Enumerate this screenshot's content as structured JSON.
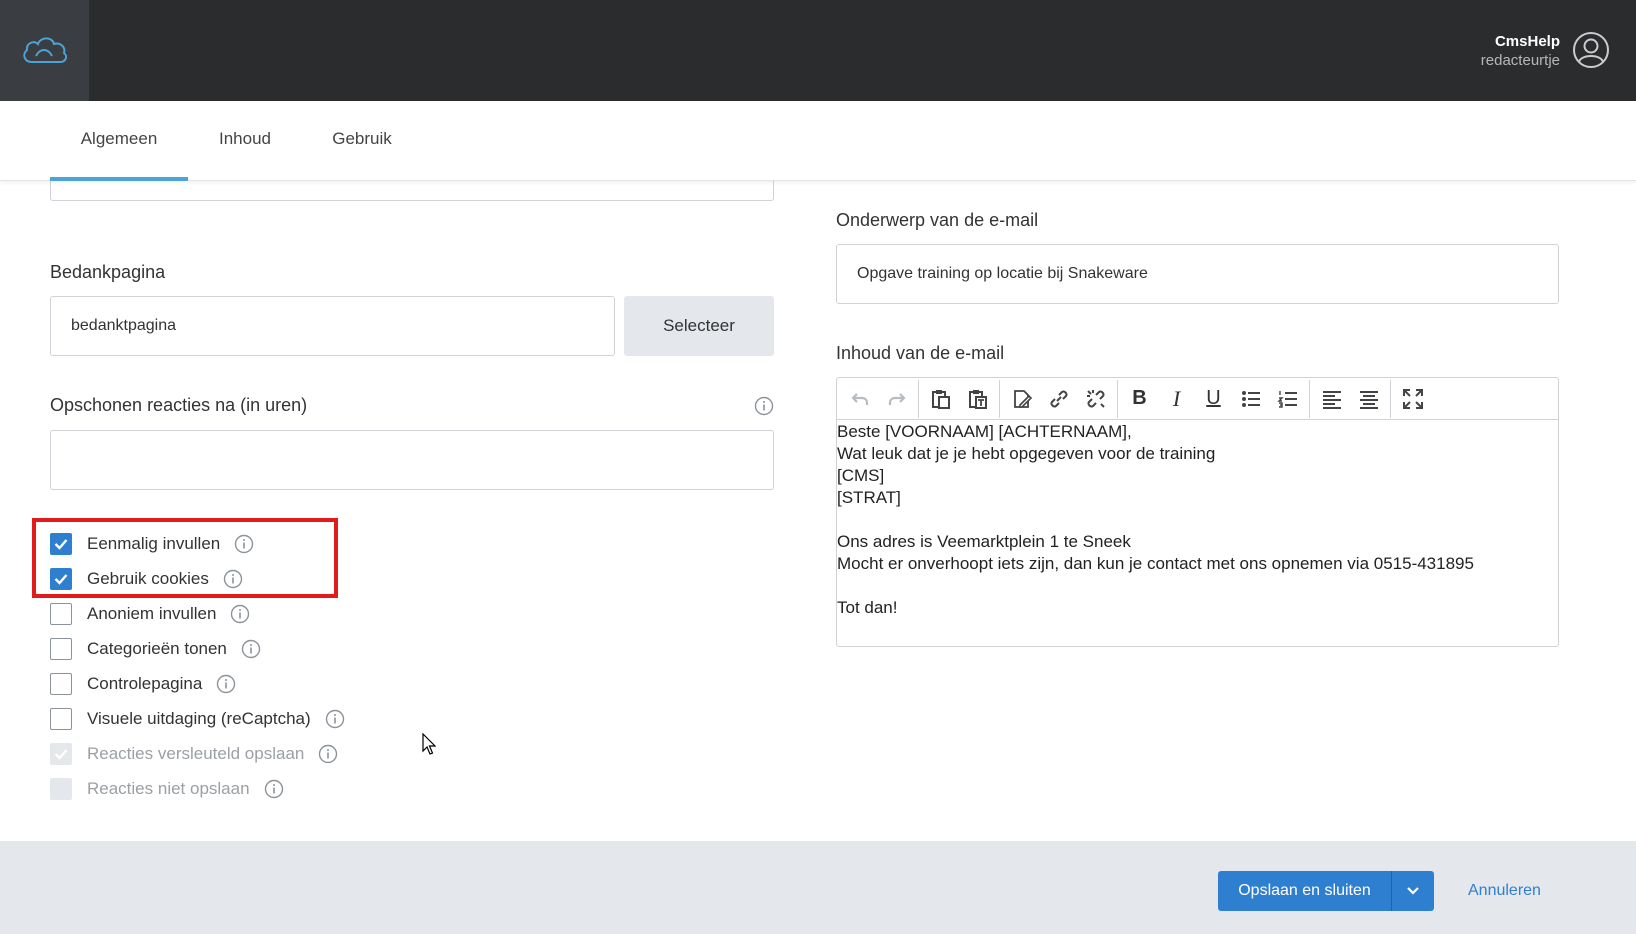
{
  "app": {
    "logo_icon": "cloud-logo-icon"
  },
  "user": {
    "name": "CmsHelp",
    "role": "redacteurtje",
    "avatar_icon": "user-avatar-icon"
  },
  "tabs": [
    {
      "label": "Algemeen",
      "active": true
    },
    {
      "label": "Inhoud",
      "active": false
    },
    {
      "label": "Gebruik",
      "active": false
    }
  ],
  "left": {
    "bedankpagina_label": "Bedankpagina",
    "bedankpagina_value": "bedanktpagina",
    "select_button": "Selecteer",
    "opschonen_label": "Opschonen reacties na (in uren)",
    "opschonen_value": ""
  },
  "checkboxes": [
    {
      "label": "Eenmalig invullen",
      "checked": true,
      "disabled": false
    },
    {
      "label": "Gebruik cookies",
      "checked": true,
      "disabled": false
    },
    {
      "label": "Anoniem invullen",
      "checked": false,
      "disabled": false
    },
    {
      "label": "Categorieën tonen",
      "checked": false,
      "disabled": false
    },
    {
      "label": "Controlepagina",
      "checked": false,
      "disabled": false
    },
    {
      "label": "Visuele uitdaging (reCaptcha)",
      "checked": false,
      "disabled": false
    },
    {
      "label": "Reacties versleuteld opslaan",
      "checked": true,
      "disabled": true
    },
    {
      "label": "Reacties niet opslaan",
      "checked": false,
      "disabled": true
    }
  ],
  "right": {
    "onderwerp_label": "Onderwerp van de e-mail",
    "onderwerp_value": "Opgave training op locatie bij Snakeware",
    "inhoud_label": "Inhoud van de e-mail",
    "email_body": [
      "Beste [VOORNAAM] [ACHTERNAAM],",
      "Wat leuk dat je je hebt opgegeven voor de training",
      "[CMS]",
      "[STRAT]",
      "",
      "Ons adres is Veemarktplein 1 te Sneek",
      "Mocht er onverhoopt iets zijn, dan kun je contact met ons opnemen via 0515-431895",
      "",
      "Tot dan!"
    ]
  },
  "toolbar": {
    "undo_icon": "undo-icon",
    "redo_icon": "redo-icon",
    "paste_icon": "paste-icon",
    "paste_text_icon": "paste-text-icon",
    "edit_link_icon": "edit-icon",
    "link_icon": "link-icon",
    "unlink_icon": "unlink-icon",
    "bold": "B",
    "italic": "I",
    "underline": "U",
    "bullet_list_icon": "bullet-list-icon",
    "numbered_list_icon": "numbered-list-icon",
    "align_left_icon": "align-left-icon",
    "align_center_icon": "align-center-icon",
    "fullscreen_icon": "fullscreen-icon"
  },
  "footer": {
    "save_label": "Opslaan en sluiten",
    "cancel_label": "Annuleren"
  },
  "colors": {
    "topbar": "#2b2c2e",
    "accent": "#2f7fd0",
    "tab_underline": "#4aa4d8",
    "highlight": "#e31b1b"
  }
}
